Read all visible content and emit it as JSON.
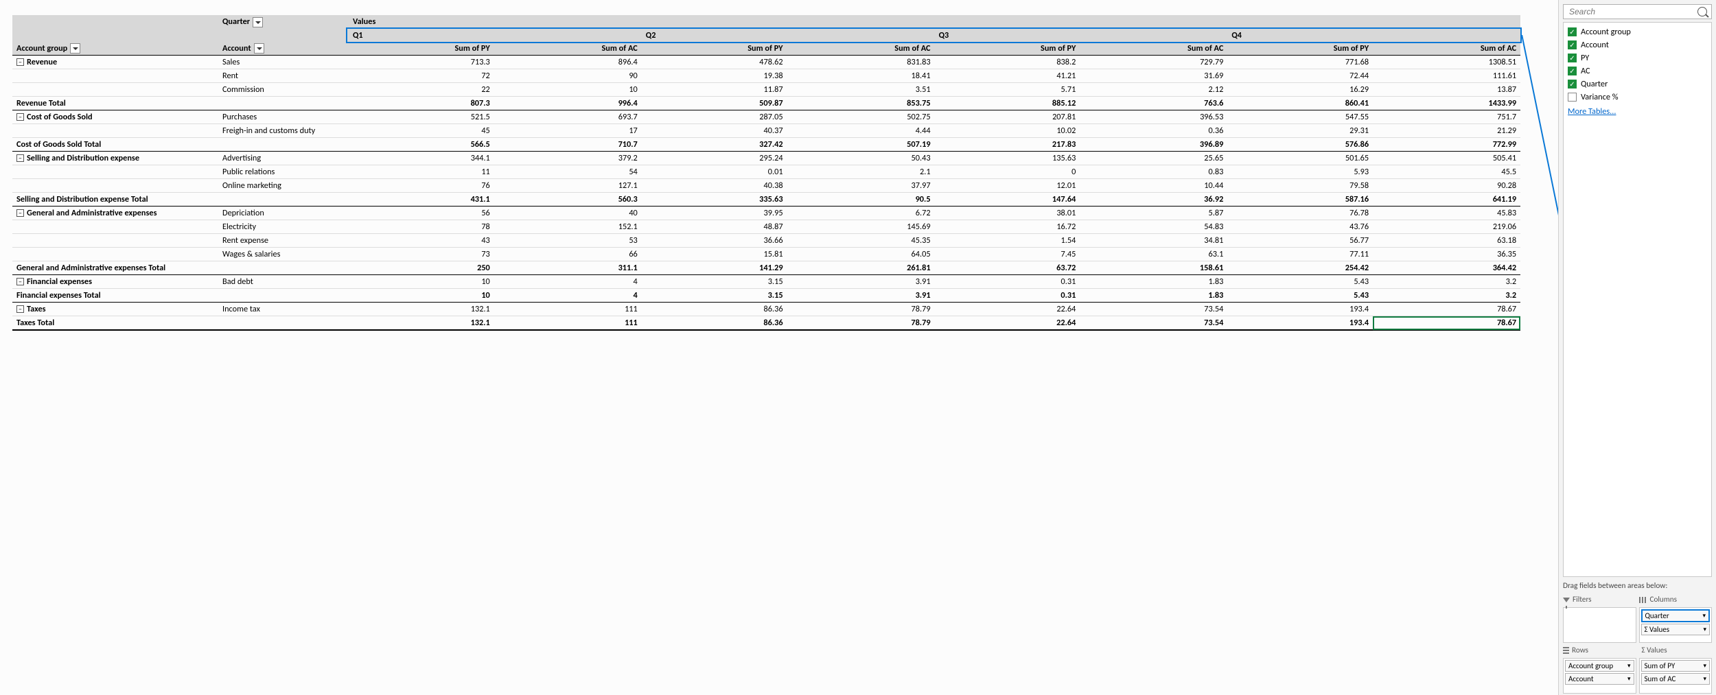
{
  "pivot": {
    "corner_label": "Quarter",
    "values_label": "Values",
    "row_field1": "Account group",
    "row_field2": "Account",
    "quarters": [
      "Q1",
      "Q2",
      "Q3",
      "Q4"
    ],
    "measures": [
      "Sum of PY",
      "Sum of AC"
    ],
    "groups": [
      {
        "name": "Revenue",
        "rows": [
          {
            "acct": "Sales",
            "v": [
              "713.3",
              "896.4",
              "478.62",
              "831.83",
              "838.2",
              "729.79",
              "771.68",
              "1308.51"
            ]
          },
          {
            "acct": "Rent",
            "v": [
              "72",
              "90",
              "19.38",
              "18.41",
              "41.21",
              "31.69",
              "72.44",
              "111.61"
            ]
          },
          {
            "acct": "Commission",
            "v": [
              "22",
              "10",
              "11.87",
              "3.51",
              "5.71",
              "2.12",
              "16.29",
              "13.87"
            ]
          }
        ],
        "total_label": "Revenue Total",
        "total": [
          "807.3",
          "996.4",
          "509.87",
          "853.75",
          "885.12",
          "763.6",
          "860.41",
          "1433.99"
        ]
      },
      {
        "name": "Cost of Goods Sold",
        "rows": [
          {
            "acct": "Purchases",
            "v": [
              "521.5",
              "693.7",
              "287.05",
              "502.75",
              "207.81",
              "396.53",
              "547.55",
              "751.7"
            ]
          },
          {
            "acct": "Freigh-in and customs duty",
            "v": [
              "45",
              "17",
              "40.37",
              "4.44",
              "10.02",
              "0.36",
              "29.31",
              "21.29"
            ]
          }
        ],
        "total_label": "Cost of Goods Sold Total",
        "total": [
          "566.5",
          "710.7",
          "327.42",
          "507.19",
          "217.83",
          "396.89",
          "576.86",
          "772.99"
        ]
      },
      {
        "name": "Selling and Distribution expense",
        "rows": [
          {
            "acct": "Advertising",
            "v": [
              "344.1",
              "379.2",
              "295.24",
              "50.43",
              "135.63",
              "25.65",
              "501.65",
              "505.41"
            ]
          },
          {
            "acct": "Public relations",
            "v": [
              "11",
              "54",
              "0.01",
              "2.1",
              "0",
              "0.83",
              "5.93",
              "45.5"
            ]
          },
          {
            "acct": "Online marketing",
            "v": [
              "76",
              "127.1",
              "40.38",
              "37.97",
              "12.01",
              "10.44",
              "79.58",
              "90.28"
            ]
          }
        ],
        "total_label": "Selling and Distribution expense Total",
        "total": [
          "431.1",
          "560.3",
          "335.63",
          "90.5",
          "147.64",
          "36.92",
          "587.16",
          "641.19"
        ]
      },
      {
        "name": "General and Administrative expenses",
        "rows": [
          {
            "acct": "Depriciation",
            "v": [
              "56",
              "40",
              "39.95",
              "6.72",
              "38.01",
              "5.87",
              "76.78",
              "45.83"
            ]
          },
          {
            "acct": "Electricity",
            "v": [
              "78",
              "152.1",
              "48.87",
              "145.69",
              "16.72",
              "54.83",
              "43.76",
              "219.06"
            ]
          },
          {
            "acct": "Rent expense",
            "v": [
              "43",
              "53",
              "36.66",
              "45.35",
              "1.54",
              "34.81",
              "56.77",
              "63.18"
            ]
          },
          {
            "acct": "Wages & salaries",
            "v": [
              "73",
              "66",
              "15.81",
              "64.05",
              "7.45",
              "63.1",
              "77.11",
              "36.35"
            ]
          }
        ],
        "total_label": "General and Administrative expenses Total",
        "total": [
          "250",
          "311.1",
          "141.29",
          "261.81",
          "63.72",
          "158.61",
          "254.42",
          "364.42"
        ]
      },
      {
        "name": "Financial expenses",
        "rows": [
          {
            "acct": "Bad debt",
            "v": [
              "10",
              "4",
              "3.15",
              "3.91",
              "0.31",
              "1.83",
              "5.43",
              "3.2"
            ]
          }
        ],
        "total_label": "Financial expenses Total",
        "total": [
          "10",
          "4",
          "3.15",
          "3.91",
          "0.31",
          "1.83",
          "5.43",
          "3.2"
        ]
      },
      {
        "name": "Taxes",
        "rows": [
          {
            "acct": "Income tax",
            "v": [
              "132.1",
              "111",
              "86.36",
              "78.79",
              "22.64",
              "73.54",
              "193.4",
              "78.67"
            ]
          }
        ],
        "total_label": "Taxes Total",
        "total": [
          "132.1",
          "111",
          "86.36",
          "78.79",
          "22.64",
          "73.54",
          "193.4",
          "78.67"
        ],
        "last_cell_selected": true
      }
    ]
  },
  "pane": {
    "search_placeholder": "Search",
    "fields": [
      {
        "label": "Account group",
        "checked": true
      },
      {
        "label": "Account",
        "checked": true
      },
      {
        "label": "PY",
        "checked": true
      },
      {
        "label": "AC",
        "checked": true
      },
      {
        "label": "Quarter",
        "checked": true
      },
      {
        "label": "Variance %",
        "checked": false
      }
    ],
    "more_tables": "More Tables...",
    "drag_hint": "Drag fields between areas below:",
    "areas": {
      "filters": {
        "title": "Filters",
        "items": []
      },
      "columns": {
        "title": "Columns",
        "items": [
          {
            "label": "Quarter",
            "hl": true
          },
          {
            "label": "Σ Values"
          }
        ]
      },
      "rows": {
        "title": "Rows",
        "items": [
          {
            "label": "Account group"
          },
          {
            "label": "Account"
          }
        ]
      },
      "values": {
        "title": "Σ  Values",
        "items": [
          {
            "label": "Sum of PY"
          },
          {
            "label": "Sum of AC"
          }
        ]
      }
    }
  }
}
